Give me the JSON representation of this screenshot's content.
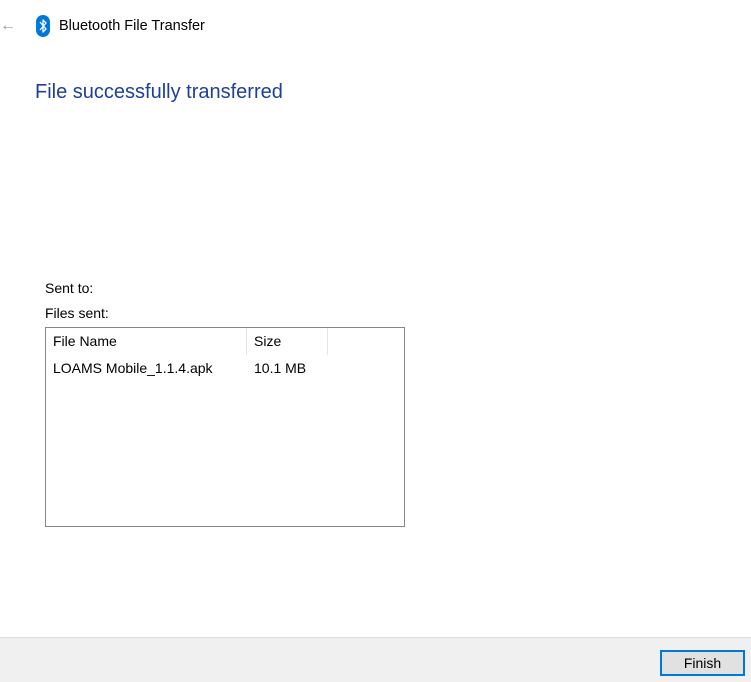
{
  "window": {
    "title": "Bluetooth File Transfer",
    "back_icon": "back-arrow-icon",
    "app_icon": "bluetooth-icon",
    "accent_color": "#0078d7"
  },
  "main": {
    "headline": "File successfully transferred",
    "headline_color": "#1e3f9a",
    "sent_to_label": "Sent to:",
    "files_sent_label": "Files sent:"
  },
  "file_list": {
    "columns": [
      {
        "label": "File Name"
      },
      {
        "label": "Size"
      }
    ],
    "rows": [
      {
        "name": "LOAMS Mobile_1.1.4.apk",
        "size": "10.1 MB"
      }
    ]
  },
  "footer": {
    "finish_label": "Finish"
  }
}
